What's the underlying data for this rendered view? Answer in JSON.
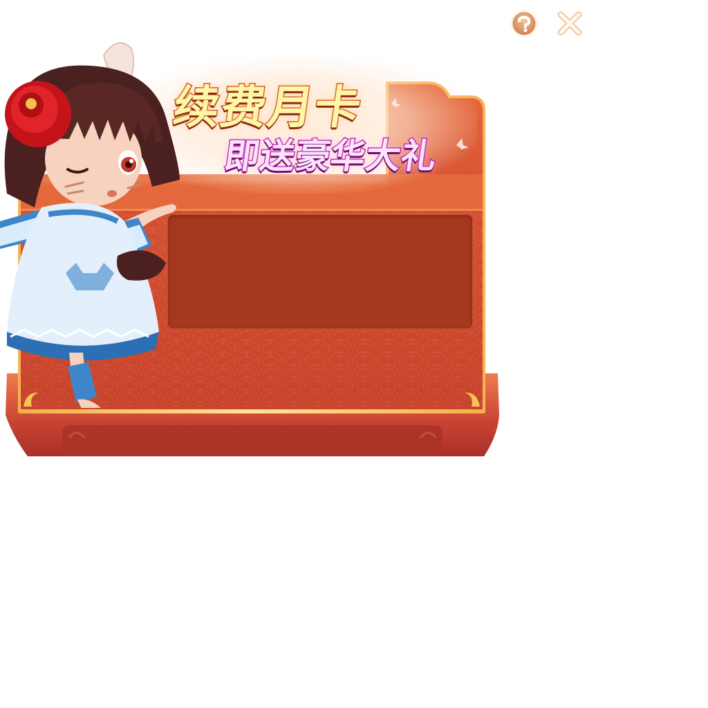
{
  "dialog": {
    "title_line1": "续费月卡",
    "title_line2": "即送豪华大礼"
  },
  "controls": {
    "help_icon": "help-icon",
    "close_icon": "close-icon"
  },
  "colors": {
    "panel_red": "#d2502f",
    "panel_dark": "#a5391f",
    "gold_border": "#f3b552",
    "title_yellow": "#fff6a8",
    "title_pink": "#fde3ff"
  }
}
